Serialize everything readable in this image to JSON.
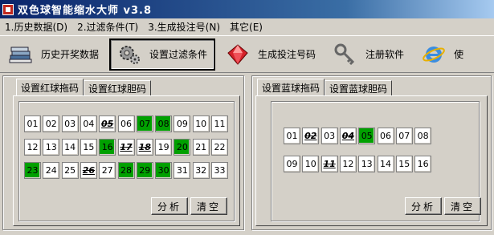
{
  "window": {
    "title": "双色球智能缩水大师 v3.8"
  },
  "menu": [
    "1.历史数据(D)",
    "2.过滤条件(T)",
    "3.生成投注号(N)",
    "其它(E)"
  ],
  "toolbar": {
    "history_label": "历史开奖数据",
    "filter_label": "设置过滤条件",
    "generate_label": "生成投注号码",
    "register_label": "注册软件",
    "partial_label": "使"
  },
  "red_panel": {
    "tabs": [
      "设置红球拖码",
      "设置红球胆码"
    ],
    "balls": [
      {
        "n": "01",
        "state": "normal"
      },
      {
        "n": "02",
        "state": "normal"
      },
      {
        "n": "03",
        "state": "normal"
      },
      {
        "n": "04",
        "state": "normal"
      },
      {
        "n": "05",
        "state": "banned"
      },
      {
        "n": "06",
        "state": "normal"
      },
      {
        "n": "07",
        "state": "selected"
      },
      {
        "n": "08",
        "state": "selected"
      },
      {
        "n": "09",
        "state": "normal"
      },
      {
        "n": "10",
        "state": "normal"
      },
      {
        "n": "11",
        "state": "normal"
      },
      {
        "n": "12",
        "state": "normal"
      },
      {
        "n": "13",
        "state": "normal"
      },
      {
        "n": "14",
        "state": "normal"
      },
      {
        "n": "15",
        "state": "normal"
      },
      {
        "n": "16",
        "state": "selected"
      },
      {
        "n": "17",
        "state": "banned"
      },
      {
        "n": "18",
        "state": "banned"
      },
      {
        "n": "19",
        "state": "normal"
      },
      {
        "n": "20",
        "state": "selected"
      },
      {
        "n": "21",
        "state": "normal"
      },
      {
        "n": "22",
        "state": "normal"
      },
      {
        "n": "23",
        "state": "selected"
      },
      {
        "n": "24",
        "state": "normal"
      },
      {
        "n": "25",
        "state": "normal"
      },
      {
        "n": "26",
        "state": "banned"
      },
      {
        "n": "27",
        "state": "normal"
      },
      {
        "n": "28",
        "state": "selected"
      },
      {
        "n": "29",
        "state": "selected"
      },
      {
        "n": "30",
        "state": "selected"
      },
      {
        "n": "31",
        "state": "normal"
      },
      {
        "n": "32",
        "state": "normal"
      },
      {
        "n": "33",
        "state": "normal"
      }
    ],
    "analyze_label": "分析",
    "clear_label": "清空"
  },
  "blue_panel": {
    "tabs": [
      "设置蓝球拖码",
      "设置蓝球胆码"
    ],
    "balls": [
      {
        "n": "01",
        "state": "normal"
      },
      {
        "n": "02",
        "state": "banned"
      },
      {
        "n": "03",
        "state": "normal"
      },
      {
        "n": "04",
        "state": "banned"
      },
      {
        "n": "05",
        "state": "selected"
      },
      {
        "n": "06",
        "state": "normal"
      },
      {
        "n": "07",
        "state": "normal"
      },
      {
        "n": "08",
        "state": "normal"
      },
      {
        "n": "09",
        "state": "normal"
      },
      {
        "n": "10",
        "state": "normal"
      },
      {
        "n": "11",
        "state": "banned"
      },
      {
        "n": "12",
        "state": "normal"
      },
      {
        "n": "13",
        "state": "normal"
      },
      {
        "n": "14",
        "state": "normal"
      },
      {
        "n": "15",
        "state": "normal"
      },
      {
        "n": "16",
        "state": "normal"
      }
    ],
    "analyze_label": "分析",
    "clear_label": "清空"
  },
  "colors": {
    "selected": "#00a000",
    "titlebar": "#0a246a"
  }
}
